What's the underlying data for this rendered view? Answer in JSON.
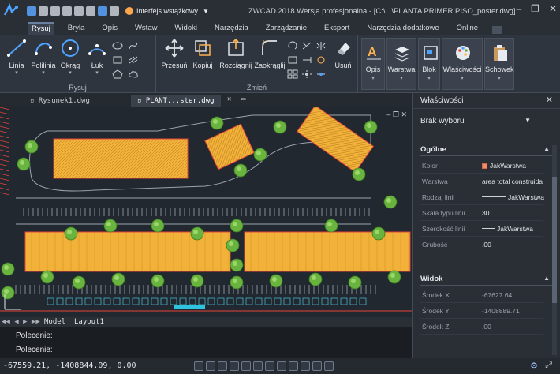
{
  "app": {
    "title": "ZWCAD 2018 Wersja profesjonalna - [C:\\...\\PLANTA PRIMER PISO_poster.dwg]",
    "workspace": "Interfejs wstążkowy"
  },
  "menu_tabs": [
    "Rysuj",
    "Bryła",
    "Opis",
    "Wstaw",
    "Widoki",
    "Narzędzia",
    "Zarządzanie",
    "Eksport",
    "Narzędzia dodatkowe",
    "Online"
  ],
  "ribbon": {
    "draw_group_label": "Rysuj",
    "modify_group_label": "Zmień",
    "draw_buttons": [
      "Linia",
      "Polilinia",
      "Okrąg",
      "Łuk"
    ],
    "modify_buttons": [
      "Przesuń",
      "Kopiuj",
      "Rozciągnij",
      "Zaokrąglij",
      "Usuń"
    ],
    "panel_buttons": [
      "Opis",
      "Warstwa",
      "Blok",
      "Właściwości",
      "Schowek"
    ]
  },
  "document_tabs": [
    "Rysunek1.dwg",
    "PLANT...ster.dwg"
  ],
  "layout_tabs": [
    "Model",
    "Layout1"
  ],
  "command": {
    "line1": "Polecenie:",
    "line2": "Polecenie:"
  },
  "status": {
    "coordinates": "-67559.21, -1408844.09, 0.00"
  },
  "properties": {
    "title": "Właściwości",
    "selection": "Brak wyboru",
    "general_section": "Ogólne",
    "general_rows": [
      {
        "key": "Kolor",
        "value": "JakWarstwa"
      },
      {
        "key": "Warstwa",
        "value": "area total construida"
      },
      {
        "key": "Rodzaj linii",
        "value": "JakWarstwa"
      },
      {
        "key": "Skala typu linii",
        "value": "30"
      },
      {
        "key": "Szerokość linii",
        "value": "JakWarstwa"
      },
      {
        "key": "Grubość",
        "value": ".00"
      }
    ],
    "view_section": "Widok",
    "view_rows": [
      {
        "key": "Środek X",
        "value": "-67627.64"
      },
      {
        "key": "Środek Y",
        "value": "-1408889.71"
      },
      {
        "key": "Środek Z",
        "value": ".00"
      }
    ]
  },
  "colors": {
    "building_fill": "#f2b23a",
    "building_outline": "#e8433a",
    "tree_green": "#69b33f",
    "canvas_bg": "#212830"
  }
}
